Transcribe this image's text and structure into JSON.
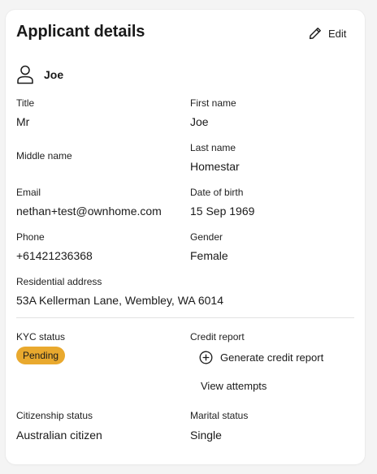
{
  "header": {
    "title": "Applicant details",
    "edit_label": "Edit"
  },
  "applicant": {
    "name": "Joe"
  },
  "fields": {
    "title": {
      "label": "Title",
      "value": "Mr"
    },
    "first_name": {
      "label": "First name",
      "value": "Joe"
    },
    "middle_name": {
      "label": "Middle name",
      "value": ""
    },
    "last_name": {
      "label": "Last name",
      "value": "Homestar"
    },
    "email": {
      "label": "Email",
      "value": "nethan+test@ownhome.com"
    },
    "dob": {
      "label": "Date of birth",
      "value": "15 Sep 1969"
    },
    "phone": {
      "label": "Phone",
      "value": "+61421236368"
    },
    "gender": {
      "label": "Gender",
      "value": "Female"
    },
    "address": {
      "label": "Residential address",
      "value": "53A Kellerman Lane, Wembley, WA 6014"
    },
    "citizenship": {
      "label": "Citizenship status",
      "value": "Australian citizen"
    },
    "marital": {
      "label": "Marital status",
      "value": "Single"
    }
  },
  "kyc": {
    "label": "KYC status",
    "status": "Pending",
    "status_color": "#e9a92e"
  },
  "credit_report": {
    "label": "Credit report",
    "generate_label": "Generate credit report",
    "attempts_label": "View attempts"
  },
  "icons": {
    "edit": "pencil-icon",
    "user": "user-icon",
    "generate": "plus-circle-icon"
  }
}
